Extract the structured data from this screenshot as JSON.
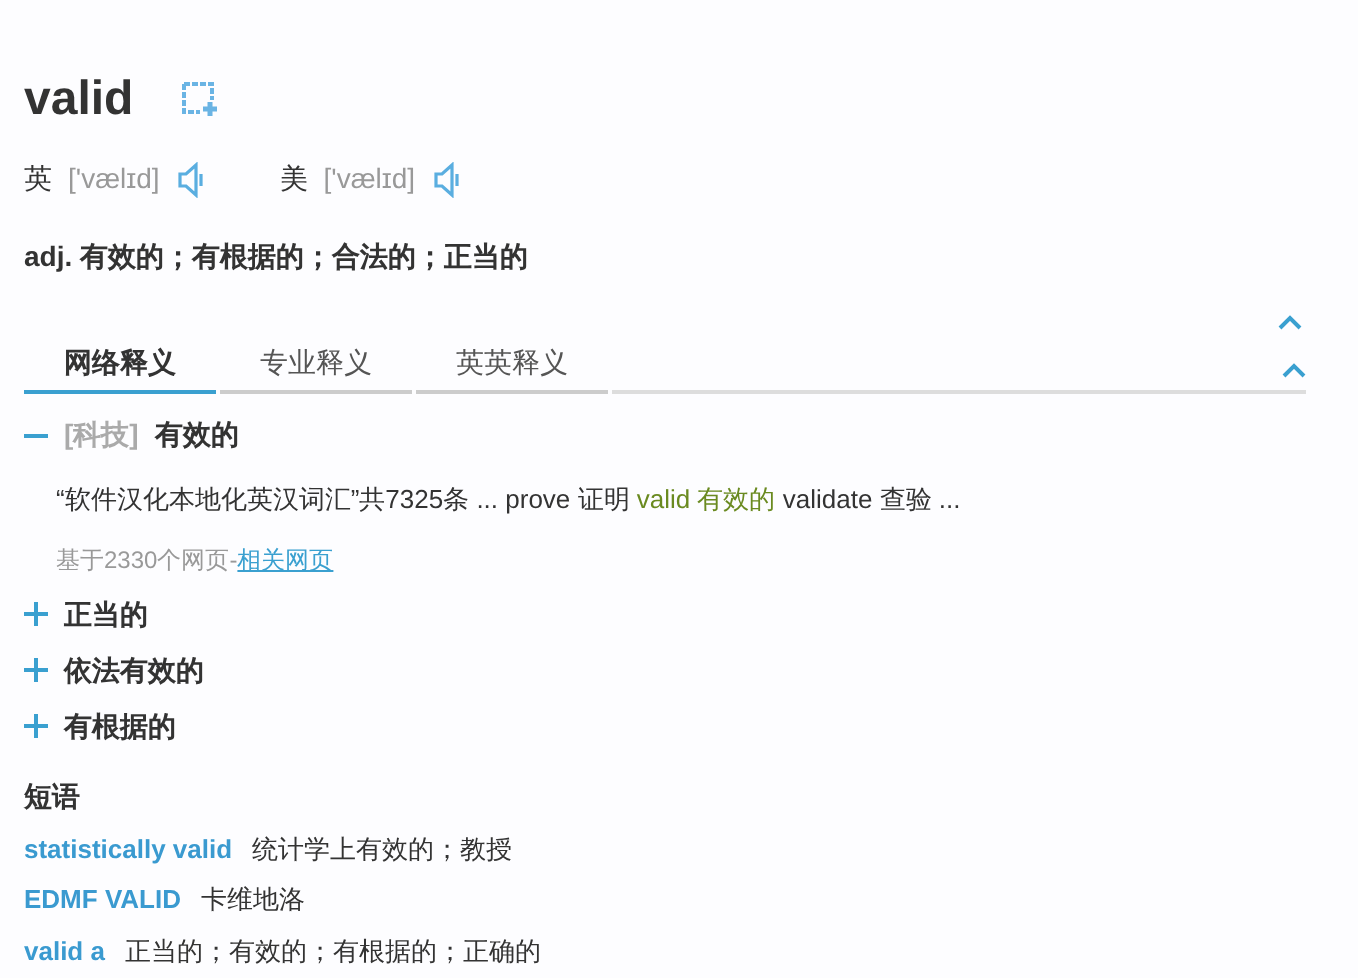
{
  "word": "valid",
  "pronunciations": [
    {
      "region": "英",
      "ipa": "['vælɪd]"
    },
    {
      "region": "美",
      "ipa": "['vælɪd]"
    }
  ],
  "definition": {
    "pos": "adj.",
    "meanings": "有效的；有根据的；合法的；正当的"
  },
  "tabs": [
    {
      "label": "网络释义",
      "selected": true
    },
    {
      "label": "专业释义",
      "selected": false
    },
    {
      "label": "英英释义",
      "selected": false
    }
  ],
  "senses": [
    {
      "expanded": true,
      "domain": "[科技]",
      "meaning": "有效的",
      "example": {
        "before": "“软件汉化本地化英汉词汇”共7325条 ... prove 证明 ",
        "highlight": "valid 有效的",
        "after": " validate 查验 ..."
      },
      "source": "基于2330个网页-",
      "source_link": "相关网页"
    },
    {
      "expanded": false,
      "meaning": "正当的"
    },
    {
      "expanded": false,
      "meaning": "依法有效的"
    },
    {
      "expanded": false,
      "meaning": "有根据的"
    }
  ],
  "phrases_title": "短语",
  "phrases": [
    {
      "phrase": "statistically valid",
      "meaning": "统计学上有效的；教授"
    },
    {
      "phrase": "EDMF VALID",
      "meaning": "卡维地洛"
    },
    {
      "phrase": "valid a",
      "meaning": "正当的；有效的；有根据的；正确的"
    }
  ]
}
